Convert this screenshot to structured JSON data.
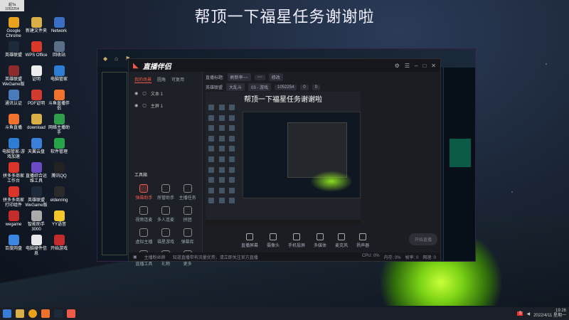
{
  "overlay_title": "帮顶一下福星任务谢谢啦",
  "desktop": {
    "cam_label": "超Ta",
    "cam_id": "1052254",
    "icons": [
      {
        "label": "Google Chrome",
        "color": "#e8a21d"
      },
      {
        "label": "新建文件夹",
        "color": "#d9b048"
      },
      {
        "label": "Network",
        "color": "#3a6fc3"
      },
      {
        "label": "英雄联盟",
        "color": "#1c2a3a"
      },
      {
        "label": "WPS Office",
        "color": "#d8392b"
      },
      {
        "label": "回收站",
        "color": "#5a6f86"
      },
      {
        "label": "英雄联盟WeGame版",
        "color": "#8c2b2b"
      },
      {
        "label": "证明",
        "color": "#eeeeee"
      },
      {
        "label": "电脑管家",
        "color": "#2d7dd2"
      },
      {
        "label": "通讯认证",
        "color": "#4b7cb9"
      },
      {
        "label": "PDF证明",
        "color": "#d33a2f"
      },
      {
        "label": "斗鱼直播伴侣",
        "color": "#f0722d"
      },
      {
        "label": "斗鱼直播",
        "color": "#f0722d"
      },
      {
        "label": "download",
        "color": "#d9b048"
      },
      {
        "label": "网络主播助手",
        "color": "#2e9e4d"
      },
      {
        "label": "电脑管家-游戏加速",
        "color": "#2d7dd2"
      },
      {
        "label": "天翼云盘",
        "color": "#3a7fd8"
      },
      {
        "label": "软件管理",
        "color": "#27a34a"
      },
      {
        "label": "拼多多商家工作台",
        "color": "#d9352b"
      },
      {
        "label": "直播综合运维工具",
        "color": "#6a4bc4"
      },
      {
        "label": "腾讯QQ",
        "color": "#222222"
      },
      {
        "label": "拼多多商家打印组件",
        "color": "#d9352b"
      },
      {
        "label": "英雄联盟WeGame版",
        "color": "#1c2a3a"
      },
      {
        "label": "eldenring",
        "color": "#2a2a2a"
      },
      {
        "label": "wegame",
        "color": "#c42b2b"
      },
      {
        "label": "智能助手3000",
        "color": "#aaaaaa"
      },
      {
        "label": "YY语音",
        "color": "#f3c62c"
      },
      {
        "label": "百度网盘",
        "color": "#3a86e0"
      },
      {
        "label": "电脑硬件信息",
        "color": "#e8e8e8"
      },
      {
        "label": "开始游戏",
        "color": "#c42b2b"
      }
    ]
  },
  "app": {
    "logo": "直播伴侣",
    "tabs": [
      "我的场景",
      "圆角",
      "可复用"
    ],
    "scenes": [
      "文本 1",
      "主屏 1"
    ],
    "tools_title": "工具箱",
    "tools": [
      "弹幕助手",
      "房管助手",
      "主播任务",
      "视频连麦",
      "多人连麦",
      "拼团",
      "虚拟主播",
      "福星游戏",
      "弹幕库",
      "直播工具",
      "礼物",
      "更多"
    ],
    "info_line1": [
      "直播标题:",
      "刷新率~~",
      "~~",
      "修改"
    ],
    "info_line2": [
      "英雄联盟",
      "大乱斗",
      "03 - 游戏",
      "1052254",
      "0",
      "0"
    ],
    "preview_title": "帮顶一下福星任务谢谢啦",
    "bottom_tools": [
      "直播屏幕",
      "摄像头",
      "手机投屏",
      "多媒体",
      "麦克风",
      "扬声器"
    ],
    "start_button": "开始直播",
    "status": [
      "主播粉丝群",
      "知道直播带有流量优势，请立即关注官方直播"
    ],
    "status_right": [
      "CPU: 0%",
      "内存: 0%",
      "帧率: 0",
      "网速: 0"
    ]
  },
  "taskbar": {
    "time": "19:26",
    "date": "2022/4/11 星期一"
  }
}
